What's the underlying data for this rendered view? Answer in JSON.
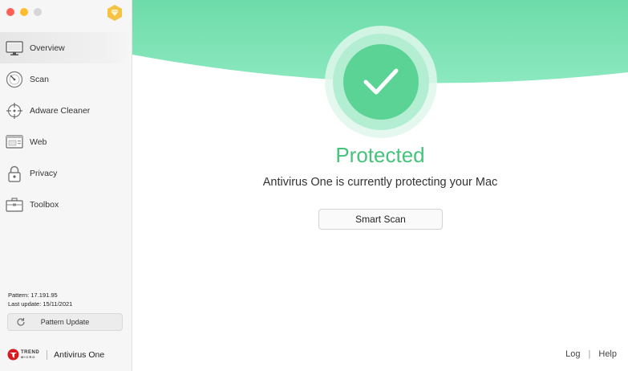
{
  "app": {
    "name": "Antivirus One"
  },
  "sidebar": {
    "items": [
      {
        "label": "Overview",
        "icon": "monitor-icon",
        "active": true
      },
      {
        "label": "Scan",
        "icon": "scan-gauge-icon"
      },
      {
        "label": "Adware Cleaner",
        "icon": "crosshair-icon"
      },
      {
        "label": "Web",
        "icon": "browser-window-icon"
      },
      {
        "label": "Privacy",
        "icon": "lock-icon"
      },
      {
        "label": "Toolbox",
        "icon": "toolbox-icon"
      }
    ],
    "pattern_label": "Pattern: 17.191.95",
    "last_update_label": "Last update: 15/11/2021",
    "pattern_update_button": "Pattern Update",
    "brand": {
      "top": "TREND",
      "bottom": "MICRO",
      "product": "Antivirus One"
    }
  },
  "main": {
    "status_title": "Protected",
    "status_message": "Antivirus One is currently protecting your Mac",
    "smart_scan_button": "Smart Scan",
    "links": {
      "log": "Log",
      "separator": "|",
      "help": "Help"
    }
  },
  "colors": {
    "accent_green": "#46c37b",
    "hero_green": "#7ee2b2",
    "brand_red": "#d71920",
    "premium_gold": "#f5c343"
  }
}
